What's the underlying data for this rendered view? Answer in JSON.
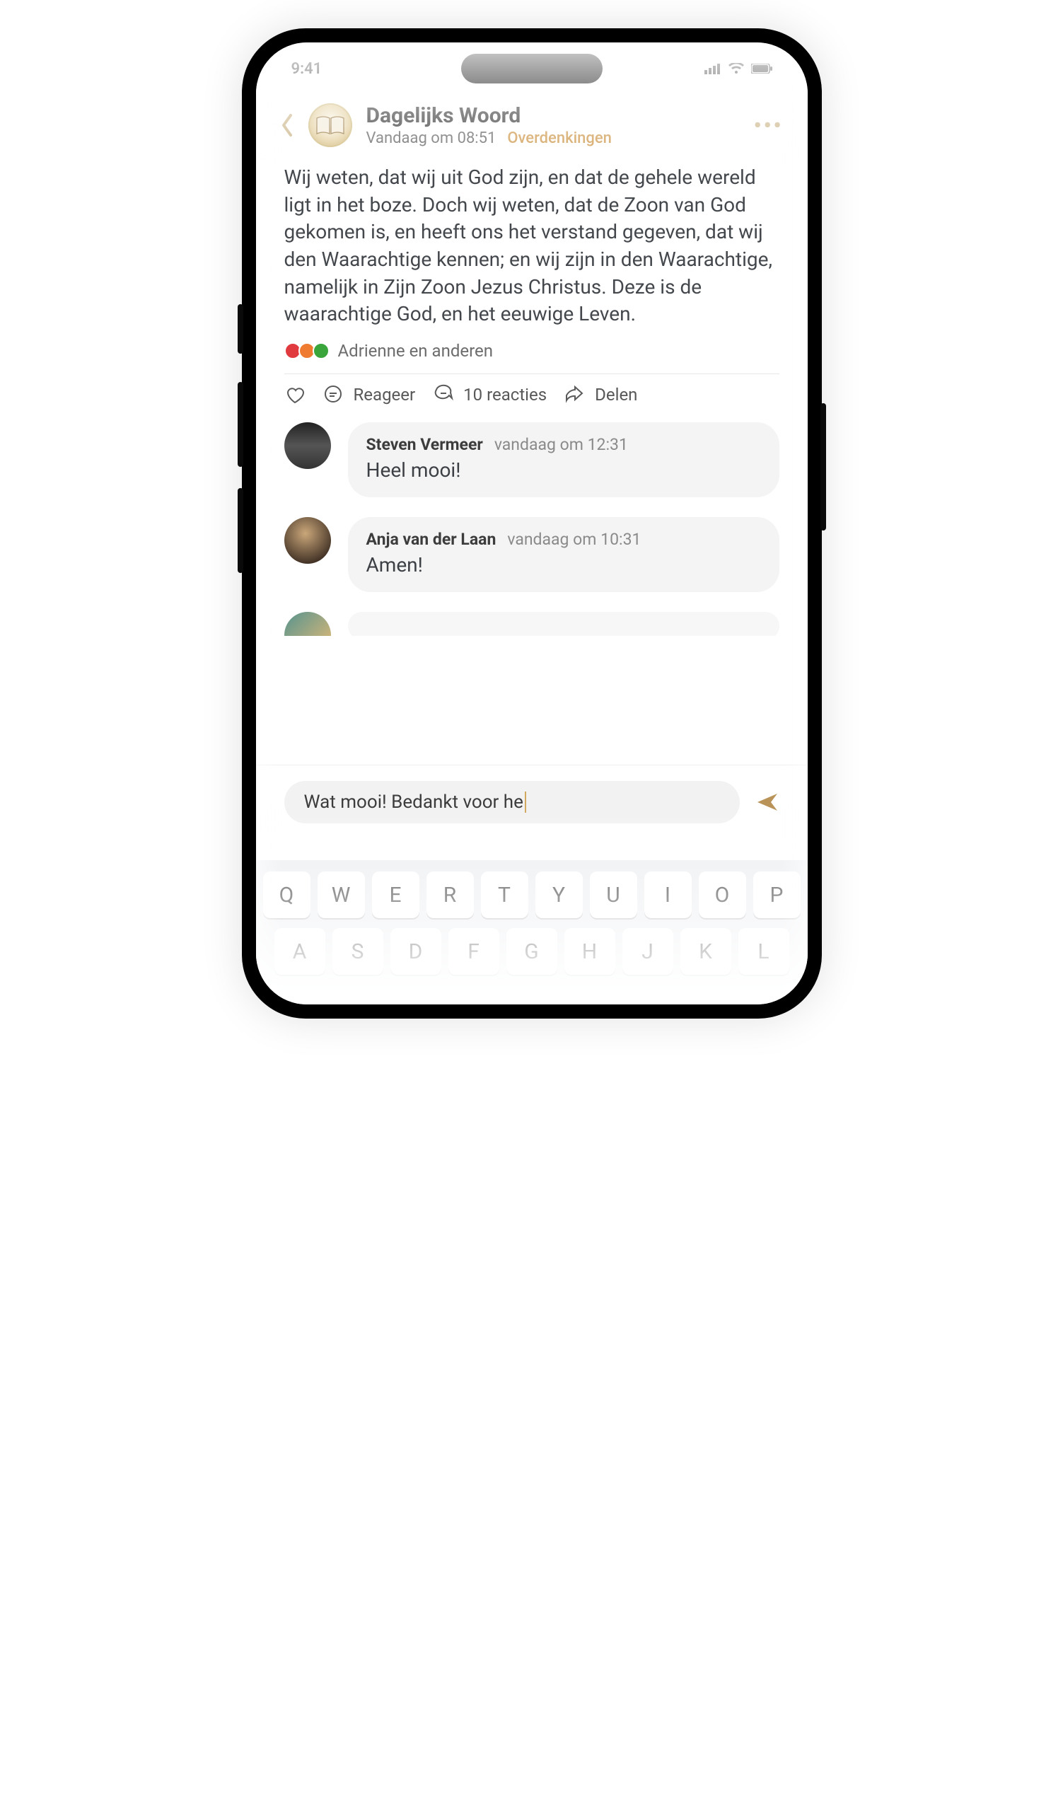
{
  "status": {
    "time": "9:41"
  },
  "header": {
    "title": "Dagelijks Woord",
    "subtitle_time": "Vandaag om 08:51",
    "subtitle_category": "Overdenkingen"
  },
  "post_text": "Wij weten,  dat wij uit God zijn, en dat de gehele wereld ligt in het boze. Doch wij weten, dat de Zoon van God gekomen is, en heeft ons het verstand  gegeven, dat wij den Waarachtige kennen; en wij zijn in den Waarachtige,  namelijk in Zijn Zoon Jezus Christus. Deze is de waarachtige God, en  het eeuwige Leven.",
  "reactions": {
    "summary": "Adrienne en anderen",
    "icons": [
      "heart",
      "flame",
      "anchor"
    ]
  },
  "actions": {
    "comment_label": "Reageer",
    "count_label": "10 reacties",
    "share_label": "Delen"
  },
  "comments": [
    {
      "name": "Steven Vermeer",
      "time": "vandaag om 12:31",
      "text": "Heel mooi!"
    },
    {
      "name": "Anja van der Laan",
      "time": "vandaag om 10:31",
      "text": "Amen!"
    }
  ],
  "compose": {
    "value": "Wat mooi! Bedankt voor he"
  },
  "keyboard": {
    "row1": [
      "Q",
      "W",
      "E",
      "R",
      "T",
      "Y",
      "U",
      "I",
      "O",
      "P"
    ],
    "row2": [
      "A",
      "S",
      "D",
      "F",
      "G",
      "H",
      "J",
      "K",
      "L"
    ]
  },
  "colors": {
    "accent": "#d2a85e",
    "text": "#44484d",
    "muted": "#7b7b7b",
    "bubble": "#f4f4f4"
  }
}
